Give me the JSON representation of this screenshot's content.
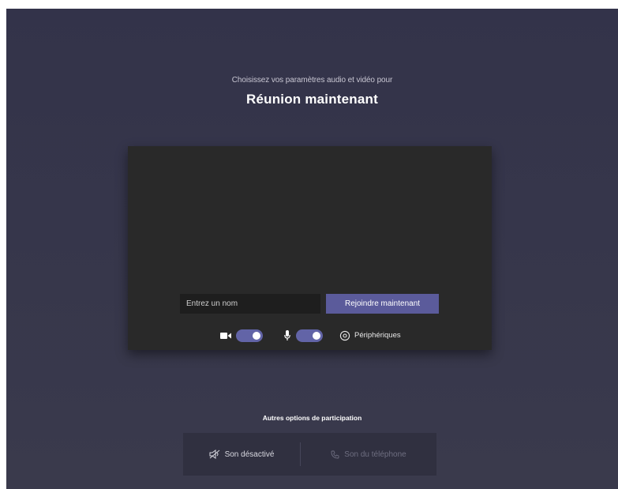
{
  "header": {
    "subtitle": "Choisissez vos paramètres audio et vidéo pour",
    "title": "Réunion maintenant"
  },
  "preview": {
    "name_placeholder": "Entrez un nom",
    "join_label": "Rejoindre maintenant",
    "camera_on": true,
    "mic_on": true,
    "devices_label": "Périphériques"
  },
  "other_options": {
    "title": "Autres options de participation",
    "audio_off_label": "Son désactivé",
    "phone_audio_label": "Son du téléphone"
  },
  "colors": {
    "background": "#34344a",
    "card": "#292929",
    "accent": "#6264a7",
    "join_button": "#5b5b9b"
  },
  "icons": {
    "camera": "camera-icon",
    "mic": "microphone-icon",
    "devices": "gear-icon",
    "audio_off": "speaker-off-icon",
    "phone": "phone-icon"
  }
}
